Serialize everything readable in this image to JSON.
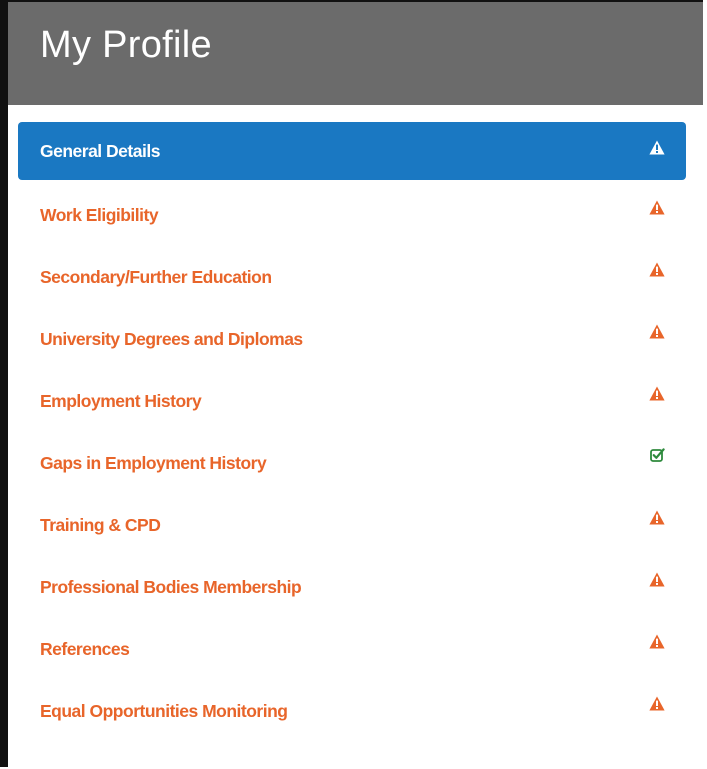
{
  "header": {
    "title": "My Profile"
  },
  "colors": {
    "header_bg": "#6b6b6b",
    "active_bg": "#1a78c2",
    "link_color": "#e8652a",
    "warning_color": "#e8652a",
    "complete_color": "#2e8a3d"
  },
  "menu": {
    "items": [
      {
        "label": "General Details",
        "status": "warning-icon",
        "active": true
      },
      {
        "label": "Work Eligibility",
        "status": "warning-icon",
        "active": false
      },
      {
        "label": "Secondary/Further Education",
        "status": "warning-icon",
        "active": false
      },
      {
        "label": "University Degrees and Diplomas",
        "status": "warning-icon",
        "active": false
      },
      {
        "label": "Employment History",
        "status": "warning-icon",
        "active": false
      },
      {
        "label": "Gaps in Employment History",
        "status": "check-square-icon",
        "active": false
      },
      {
        "label": "Training & CPD",
        "status": "warning-icon",
        "active": false
      },
      {
        "label": "Professional Bodies Membership",
        "status": "warning-icon",
        "active": false
      },
      {
        "label": "References",
        "status": "warning-icon",
        "active": false
      },
      {
        "label": "Equal Opportunities Monitoring",
        "status": "warning-icon",
        "active": false
      }
    ]
  }
}
